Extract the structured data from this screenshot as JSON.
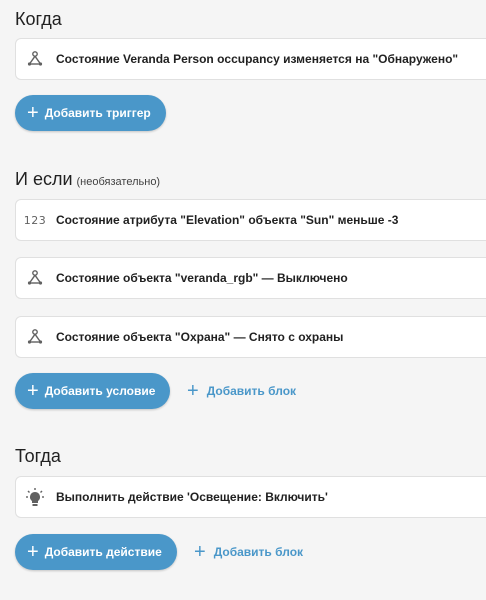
{
  "when": {
    "title": "Когда",
    "triggers": [
      {
        "icon": "device-hub-icon",
        "text": "Состояние Veranda Person occupancy изменяется на \"Обнаружено\""
      }
    ],
    "add_trigger_label": "Добавить триггер"
  },
  "if": {
    "title": "И если",
    "optional_label": "(необязательно)",
    "conditions": [
      {
        "icon": "numeric-123-icon",
        "icon_text": "123",
        "text": "Состояние атрибута \"Elevation\" объекта \"Sun\" меньше -3"
      },
      {
        "icon": "device-hub-icon",
        "text": "Состояние объекта \"veranda_rgb\" — Выключено"
      },
      {
        "icon": "device-hub-icon",
        "text": "Состояние объекта \"Охрана\" — Снято с охраны"
      }
    ],
    "add_condition_label": "Добавить условие",
    "add_block_label": "Добавить блок"
  },
  "then": {
    "title": "Тогда",
    "actions": [
      {
        "icon": "lightbulb-icon",
        "text": "Выполнить действие 'Освещение: Включить'"
      }
    ],
    "add_action_label": "Добавить действие",
    "add_block_label": "Добавить блок"
  },
  "colors": {
    "accent": "#4a97c9",
    "background": "#f5f5f5",
    "card": "#ffffff"
  }
}
